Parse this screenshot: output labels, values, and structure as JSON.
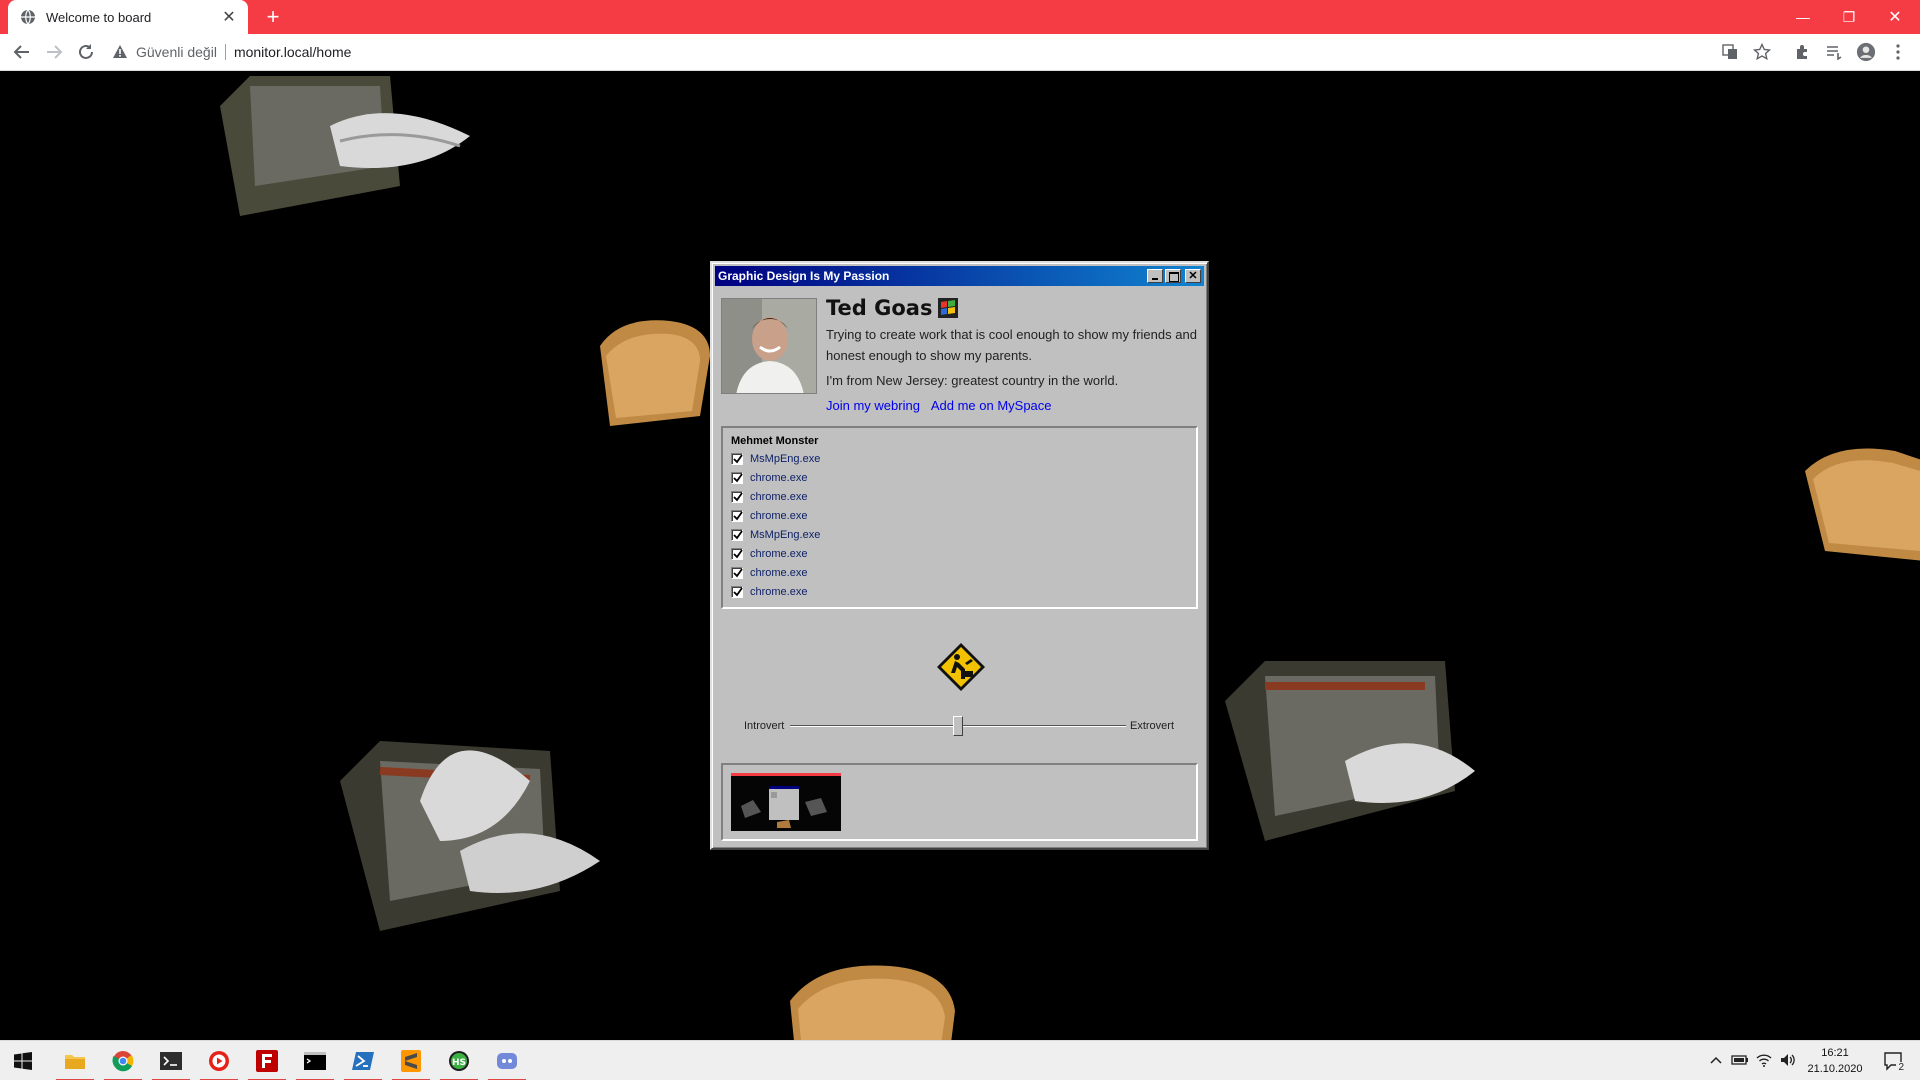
{
  "browser": {
    "tab_title": "Welcome to board",
    "new_tab": "+",
    "security_label": "Güvenli değil",
    "url": "monitor.local/home"
  },
  "window": {
    "title": "Graphic Design Is My Passion",
    "name": "Ted Goas",
    "bio": "Trying to create work that is cool enough to show my friends and honest enough to show my parents.",
    "location": "I'm from New Jersey: greatest country in the world.",
    "links": [
      "Join my webring",
      "Add me on MySpace"
    ],
    "process_panel": {
      "title": "Mehmet Monster",
      "processes": [
        {
          "name": "MsMpEng.exe",
          "checked": true
        },
        {
          "name": "chrome.exe",
          "checked": true
        },
        {
          "name": "chrome.exe",
          "checked": true
        },
        {
          "name": "chrome.exe",
          "checked": true
        },
        {
          "name": "MsMpEng.exe",
          "checked": true
        },
        {
          "name": "chrome.exe",
          "checked": true
        },
        {
          "name": "chrome.exe",
          "checked": true
        },
        {
          "name": "chrome.exe",
          "checked": true
        }
      ]
    },
    "slider": {
      "left_label": "Introvert",
      "right_label": "Extrovert",
      "value": 0.5
    }
  },
  "taskbar": {
    "apps": [
      "windows-start",
      "file-explorer",
      "chrome",
      "terminal",
      "media-player",
      "filezilla",
      "cmd",
      "powershell",
      "sublime-text",
      "hs-app",
      "discord"
    ],
    "time": "16:21",
    "date": "21.10.2020",
    "notification_count": "2"
  },
  "colors": {
    "tab_strip": "#f53c45",
    "win_title_start": "#000080",
    "win_title_end": "#1084d0",
    "win_face": "#c0c0c0",
    "link": "#0000ee"
  }
}
